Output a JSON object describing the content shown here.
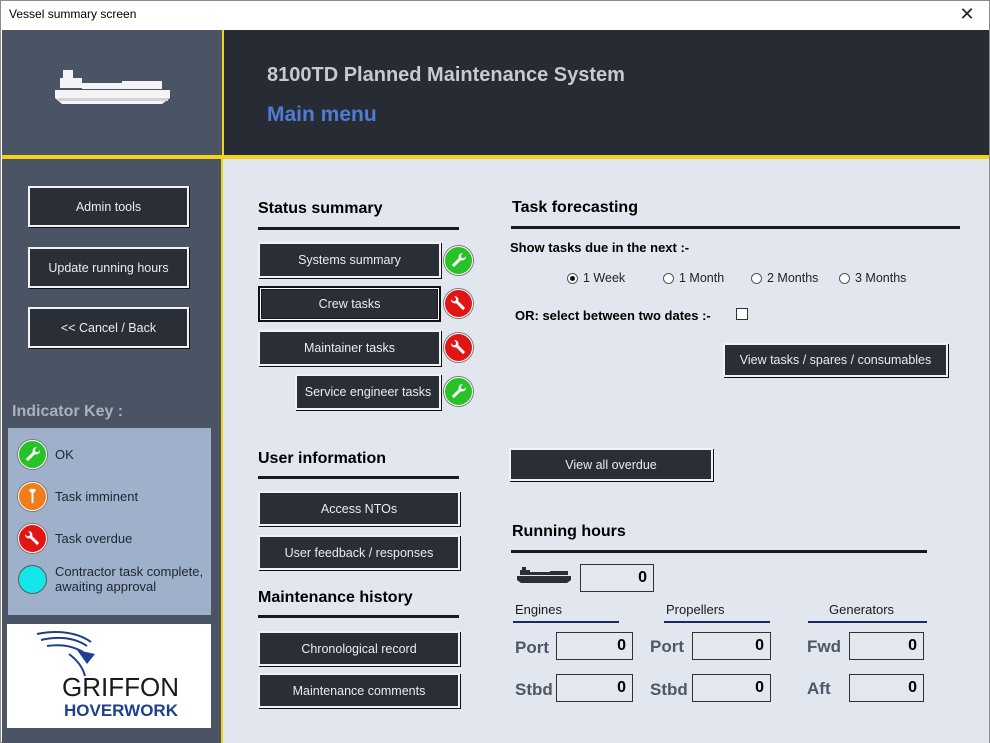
{
  "window": {
    "title": "Vessel summary screen",
    "close_glyph": "✕"
  },
  "header": {
    "system_title": "8100TD Planned Maintenance System",
    "menu_title": "Main menu"
  },
  "sidebar": {
    "admin_tools": "Admin tools",
    "update_running_hours": "Update running hours",
    "cancel_back": "<< Cancel / Back"
  },
  "indicator_key": {
    "title": "Indicator Key :",
    "ok": "OK",
    "imminent": "Task imminent",
    "overdue": "Task overdue",
    "contractor_line1": "Contractor task complete,",
    "contractor_line2": "awaiting approval"
  },
  "logo": {
    "line1": "GRIFFON",
    "line2": "HOVERWORK"
  },
  "status_summary": {
    "title": "Status summary",
    "systems_summary": "Systems summary",
    "crew_tasks": "Crew tasks",
    "maintainer_tasks": "Maintainer tasks",
    "service_engineer_tasks": "Service engineer tasks"
  },
  "user_information": {
    "title": "User information",
    "access_ntos": "Access NTOs",
    "user_feedback": "User feedback / responses"
  },
  "maintenance_history": {
    "title": "Maintenance history",
    "chronological_record": "Chronological record",
    "maintenance_comments": "Maintenance comments"
  },
  "task_forecasting": {
    "title": "Task forecasting",
    "show_tasks_label": "Show tasks due in the next :-",
    "options": [
      "1 Week",
      "1 Month",
      "2 Months",
      "3 Months"
    ],
    "selected": "1 Week",
    "between_dates_label": "OR: select between two dates :-",
    "view_tasks": "View tasks / spares / consumables",
    "view_overdue": "View all overdue"
  },
  "running_hours": {
    "title": "Running hours",
    "vessel_value": "0",
    "engines": {
      "title": "Engines",
      "port_label": "Port",
      "port": "0",
      "stbd_label": "Stbd",
      "stbd": "0"
    },
    "propellers": {
      "title": "Propellers",
      "port_label": "Port",
      "port": "0",
      "stbd_label": "Stbd",
      "stbd": "0"
    },
    "generators": {
      "title": "Generators",
      "fwd_label": "Fwd",
      "fwd": "0",
      "aft_label": "Aft",
      "aft": "0"
    }
  },
  "colors": {
    "accent_yellow": "#f5d21a",
    "header_dark": "#262b34",
    "panel": "#4a5464",
    "main_bg": "#e2e6ee",
    "title_blue": "#4f7cd6"
  }
}
